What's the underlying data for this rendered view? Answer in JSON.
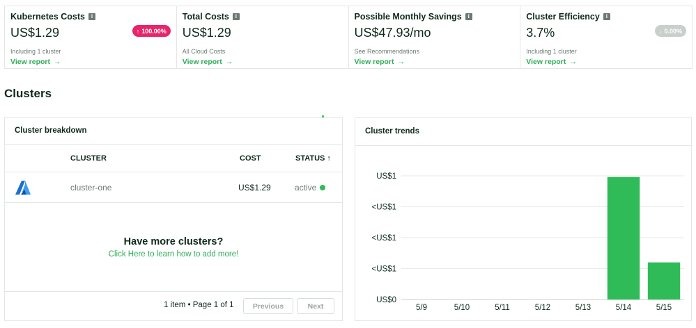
{
  "kpis": [
    {
      "title": "Kubernetes Costs",
      "value": "US$1.29",
      "badge": "100.00%",
      "badge_dir": "up",
      "badge_color": "#e8246b",
      "note": "Including 1 cluster",
      "link": "View report"
    },
    {
      "title": "Total Costs",
      "value": "US$1.29",
      "note": "All Cloud Costs",
      "link": "View report"
    },
    {
      "title": "Possible Monthly Savings",
      "value": "US$47.93/mo",
      "note": "See Recommendations",
      "link": "View report"
    },
    {
      "title": "Cluster Efficiency",
      "value": "3.7%",
      "badge": "0.00%",
      "badge_dir": "down",
      "badge_color": "#c9d0cc",
      "note": "Including 1 cluster",
      "link": "View report"
    }
  ],
  "section_title": "Clusters",
  "breakdown": {
    "title": "Cluster breakdown",
    "columns": {
      "cluster": "CLUSTER",
      "cost": "COST",
      "status": "STATUS ↑"
    },
    "rows": [
      {
        "icon": "azure-icon",
        "name": "cluster-one",
        "cost": "US$1.29",
        "status": "active",
        "status_color": "#2fbb57"
      }
    ],
    "promo_title": "Have more clusters?",
    "promo_link": "Click Here to learn how to add more!",
    "pager_info": "1 item • Page 1 of 1",
    "prev_label": "Previous",
    "next_label": "Next"
  },
  "trends": {
    "title": "Cluster trends"
  },
  "chart_data": {
    "type": "bar",
    "categories": [
      "5/9",
      "5/10",
      "5/11",
      "5/12",
      "5/13",
      "5/14",
      "5/15"
    ],
    "values": [
      0,
      0,
      0,
      0,
      0,
      0.99,
      0.3
    ],
    "ytick_labels": [
      "US$0",
      "<US$1",
      "<US$1",
      "<US$1",
      "US$1"
    ],
    "ylim": [
      0,
      1
    ],
    "grid": true,
    "bar_color": "#2fbb57"
  },
  "colors": {
    "accent": "#2fae58",
    "text": "#0e2a1b"
  }
}
